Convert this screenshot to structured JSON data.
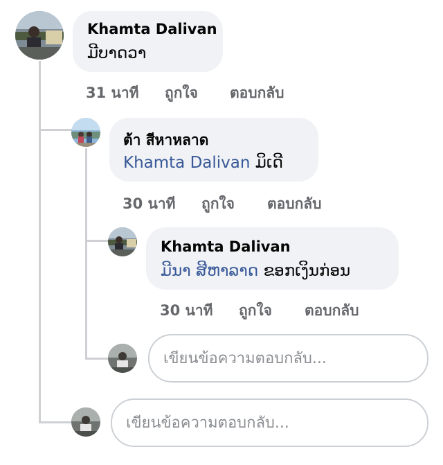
{
  "comments": [
    {
      "author": "Khamta Dalivan",
      "text": "ມີບາດວາ",
      "time": "31 นาที",
      "like": "ถูกใจ",
      "reply": "ตอบกลับ"
    },
    {
      "author": "ต้า สีหาหลาด",
      "mention": "Khamta Dalivan",
      "text": "ມິເດີ",
      "time": "30 นาที",
      "like": "ถูกใจ",
      "reply": "ตอบกลับ"
    },
    {
      "author": "Khamta Dalivan",
      "mention": "ມີນາ ສີຫາລາດ",
      "text": "ຂອກເງິນກ່ອນ",
      "time": "30 นาที",
      "like": "ถูกใจ",
      "reply": "ตอบกลับ"
    }
  ],
  "reply_inputs": [
    {
      "placeholder": "เขียนข้อความตอบกลับ..."
    },
    {
      "placeholder": "เขียนข้อความตอบกลับ..."
    }
  ],
  "colors": {
    "bubble": "#f0f2f5",
    "mention": "#385898",
    "meta": "#65676b",
    "thread_line": "#ced0d4"
  }
}
